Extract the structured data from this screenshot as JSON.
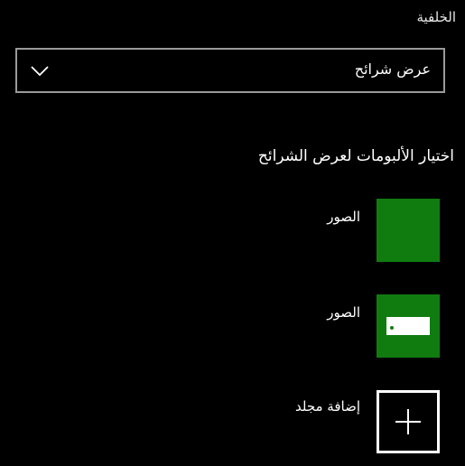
{
  "background": {
    "label": "الخلفية",
    "selected": "عرض شرائح"
  },
  "slideshow": {
    "heading": "اختيار الألبومات لعرض الشرائح",
    "albums": [
      {
        "label": "الصور",
        "tile_icon": "none"
      },
      {
        "label": "الصور",
        "tile_icon": "image-placeholder-icon"
      }
    ],
    "add_folder_label": "إضافة مجلد"
  },
  "colors": {
    "accent": "#107c10",
    "background": "#000000",
    "border": "#9a9a9a"
  }
}
